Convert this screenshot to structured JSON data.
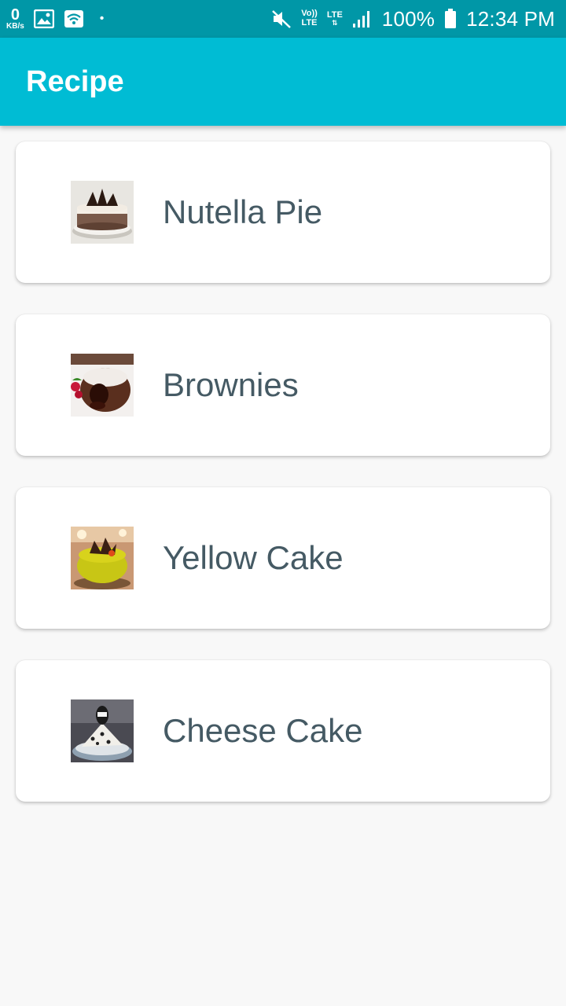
{
  "status_bar": {
    "speed_value": "0",
    "speed_unit": "KB/s",
    "volte_top": "Vo))",
    "volte_bottom": "LTE",
    "lte_label": "LTE",
    "battery": "100%",
    "time": "12:34 PM",
    "icons": [
      "image-icon",
      "wifi-icon",
      "mute-icon",
      "signal-icon",
      "battery-icon"
    ]
  },
  "app_bar": {
    "title": "Recipe",
    "color": "#00bcd4"
  },
  "recipes": [
    {
      "name": "Nutella Pie",
      "image": "nutella-pie-image"
    },
    {
      "name": "Brownies",
      "image": "brownies-image"
    },
    {
      "name": "Yellow Cake",
      "image": "yellow-cake-image"
    },
    {
      "name": "Cheese Cake",
      "image": "cheese-cake-image"
    }
  ]
}
